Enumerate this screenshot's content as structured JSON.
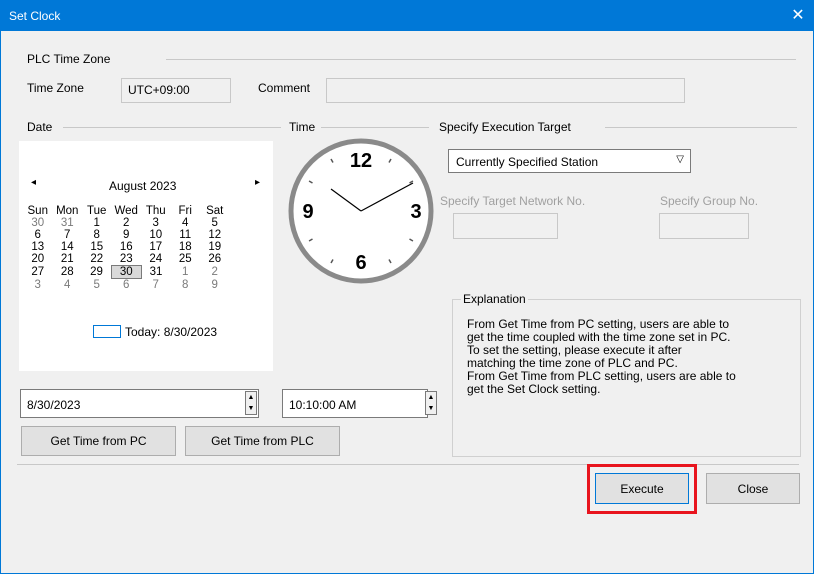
{
  "window": {
    "title": "Set Clock",
    "close_glyph": "✕"
  },
  "plc_time_zone": {
    "group_label": "PLC Time Zone",
    "time_zone_label": "Time Zone",
    "time_zone_value": "UTC+09:00",
    "comment_label": "Comment",
    "comment_value": ""
  },
  "date": {
    "group_label": "Date",
    "calendar": {
      "month_title": "August 2023",
      "prev_glyph": "◂",
      "next_glyph": "▸",
      "weekdays": [
        "Sun",
        "Mon",
        "Tue",
        "Wed",
        "Thu",
        "Fri",
        "Sat"
      ],
      "weeks": [
        [
          "30",
          "31",
          "1",
          "2",
          "3",
          "4",
          "5"
        ],
        [
          "6",
          "7",
          "8",
          "9",
          "10",
          "11",
          "12"
        ],
        [
          "13",
          "14",
          "15",
          "16",
          "17",
          "18",
          "19"
        ],
        [
          "20",
          "21",
          "22",
          "23",
          "24",
          "25",
          "26"
        ],
        [
          "27",
          "28",
          "29",
          "30",
          "31",
          "1",
          "2"
        ],
        [
          "3",
          "4",
          "5",
          "6",
          "7",
          "8",
          "9"
        ]
      ],
      "selected": "30",
      "today_label": "Today: 8/30/2023"
    },
    "date_value": "8/30/2023"
  },
  "time": {
    "group_label": "Time",
    "clock_numbers": [
      "12",
      "3",
      "6",
      "9"
    ],
    "time_value": "10:10:00 AM"
  },
  "buttons": {
    "get_time_from_pc": "Get Time from PC",
    "get_time_from_plc": "Get Time from PLC",
    "execute": "Execute",
    "close": "Close"
  },
  "execution_target": {
    "group_label": "Specify Execution Target",
    "selected_option": "Currently Specified Station",
    "network_label": "Specify Target Network No.",
    "group_no_label": "Specify Group No.",
    "network_value": "",
    "group_no_value": ""
  },
  "explanation": {
    "label": "Explanation",
    "lines": [
      "From Get Time from PC setting, users are able to",
      "get the time coupled with the time zone set in PC.",
      "To set the setting, please execute it after",
      "matching the time zone of PLC and PC.",
      "From Get Time from PLC setting, users are able to",
      "get the Set Clock setting."
    ]
  },
  "colors": {
    "title_bar": "#0078d7",
    "highlight": "#e8141e"
  }
}
